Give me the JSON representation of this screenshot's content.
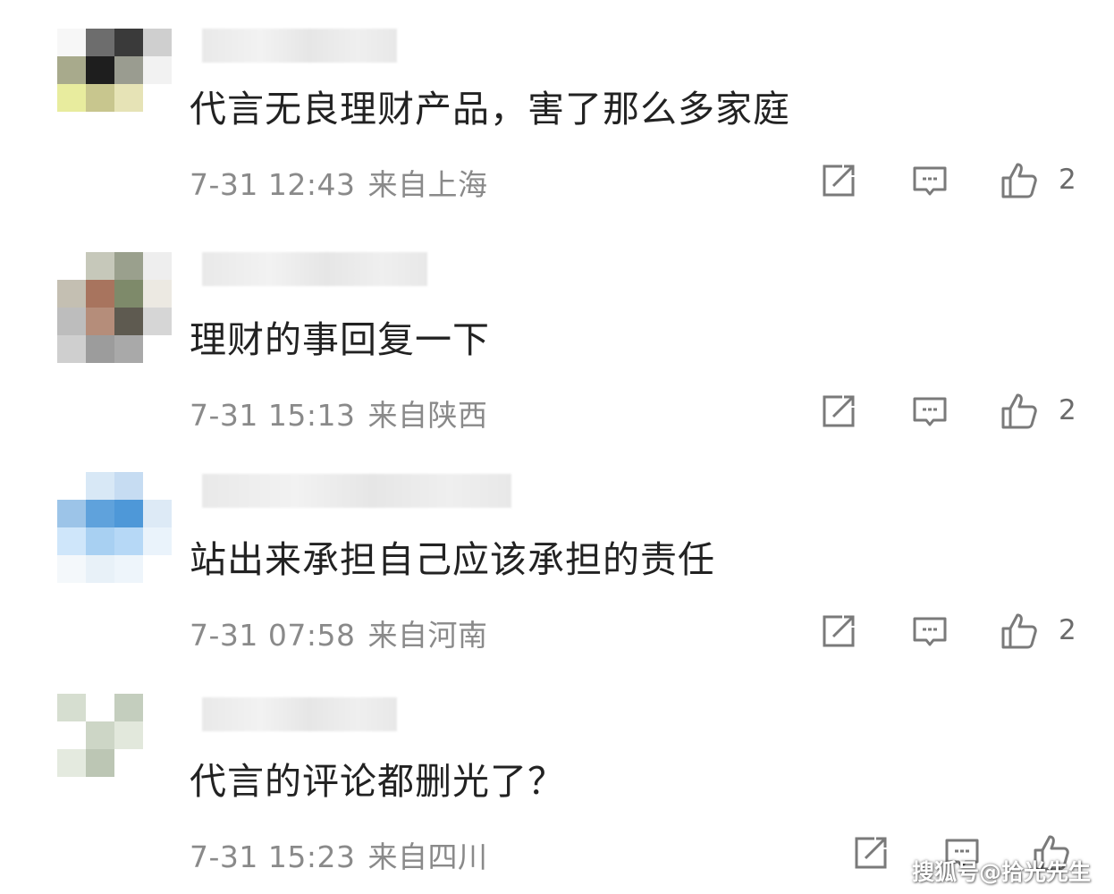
{
  "comments": [
    {
      "text": "代言无良理财产品，害了那么多家庭",
      "date": "7-31 12:43",
      "location": "来自上海",
      "likes": "2",
      "avatar_colors": [
        "#f7f7f7",
        "#6d6d6d",
        "#3a3a3a",
        "#cfcfcf",
        "#a8aa8c",
        "#1e1e1e",
        "#9a9c90",
        "#f2f2f2",
        "#e8ec9e",
        "#c8c68e",
        "#e6e3b6",
        "#ffffff",
        "#ffffff",
        "#ffffff",
        "#ffffff",
        "#ffffff"
      ]
    },
    {
      "text": "理财的事回复一下",
      "date": "7-31 15:13",
      "location": "来自陕西",
      "likes": "2",
      "avatar_colors": [
        "#ffffff",
        "#c6c8ba",
        "#9aa08d",
        "#eeeeee",
        "#c4bfb2",
        "#a8745e",
        "#7e8a6a",
        "#ece9e2",
        "#bdbdbd",
        "#b58d7a",
        "#5e5a50",
        "#d6d6d6",
        "#cfcfcf",
        "#9c9c9c",
        "#a9a9a9",
        "#ffffff"
      ]
    },
    {
      "text": "站出来承担自己应该承担的责任",
      "date": "7-31 07:58",
      "location": "来自河南",
      "likes": "2",
      "avatar_colors": [
        "#ffffff",
        "#d8e8f6",
        "#c6dcf2",
        "#ffffff",
        "#9cc4e8",
        "#5fa2dc",
        "#4e98d8",
        "#ddeaf6",
        "#cfe6fa",
        "#a8d0f2",
        "#b6d8f6",
        "#eaf3fb",
        "#f4f8fb",
        "#e8f1f8",
        "#eef5fb",
        "#ffffff"
      ]
    },
    {
      "text": "代言的评论都删光了？",
      "date": "7-31 15:23",
      "location": "来自四川",
      "likes": "",
      "avatar_colors": [
        "#d6ded0",
        "#ffffff",
        "#c4cebe",
        "#ffffff",
        "#ffffff",
        "#cdd6c6",
        "#e2e8dc",
        "#ffffff",
        "#e4eadf",
        "#bcc6b4",
        "#ffffff",
        "#ffffff",
        "#ffffff",
        "#ffffff",
        "#ffffff",
        "#ffffff"
      ]
    }
  ],
  "icons": {
    "repost": "share-edit-icon",
    "comment": "comment-icon",
    "like": "thumbs-up-icon"
  },
  "colors": {
    "text": "#222222",
    "meta": "#8a8a8a",
    "icon": "#7a7a7a"
  },
  "watermark": "搜狐号@拾光先生"
}
